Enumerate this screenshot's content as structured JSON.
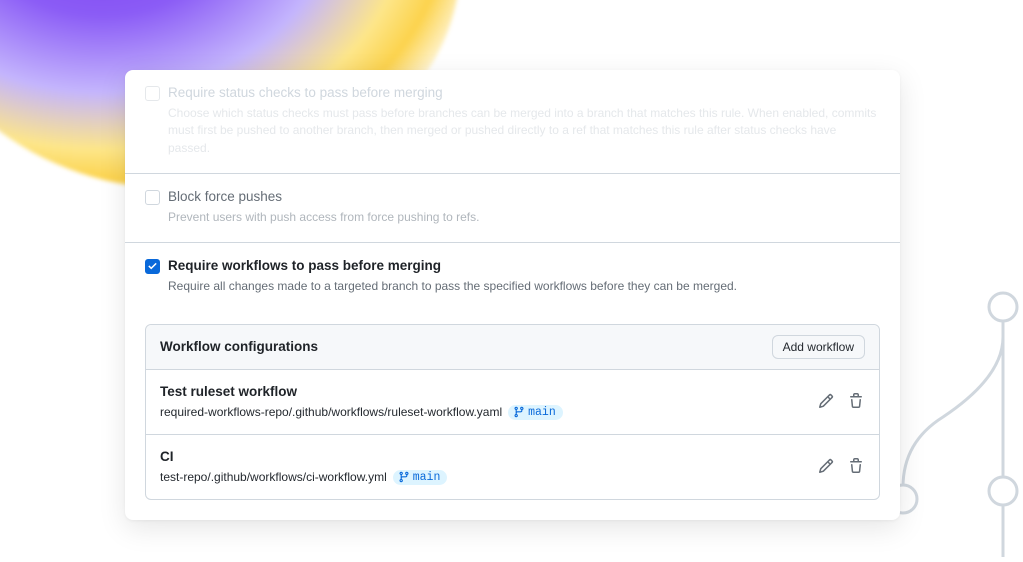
{
  "rules": {
    "statusChecks": {
      "title": "Require status checks to pass before merging",
      "desc": "Choose which status checks must pass before branches can be merged into a branch that matches this rule. When enabled, commits must first be pushed to another branch, then merged or pushed directly to a ref that matches this rule after status checks have passed."
    },
    "blockForce": {
      "title": "Block force pushes",
      "desc": "Prevent users with push access from force pushing to refs."
    },
    "workflows": {
      "title": "Require workflows to pass before merging",
      "desc": "Require all changes made to a targeted branch to pass the specified workflows before they can be merged."
    }
  },
  "configs": {
    "heading": "Workflow configurations",
    "addLabel": "Add workflow",
    "items": [
      {
        "name": "Test ruleset workflow",
        "path": "required-workflows-repo/.github/workflows/ruleset-workflow.yaml",
        "branch": "main"
      },
      {
        "name": "CI",
        "path": "test-repo/.github/workflows/ci-workflow.yml",
        "branch": "main"
      }
    ]
  }
}
